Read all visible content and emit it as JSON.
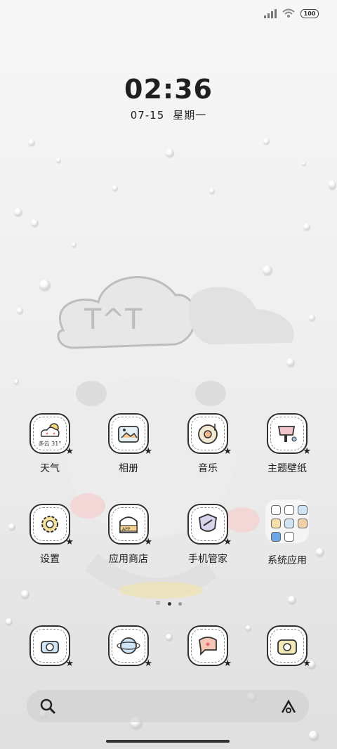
{
  "status_bar": {
    "battery": "100"
  },
  "clock": {
    "time": "02:36",
    "date": "07-15",
    "weekday": "星期一"
  },
  "apps_row1": [
    {
      "label": "天气",
      "mini": "多云 31°"
    },
    {
      "label": "相册"
    },
    {
      "label": "音乐"
    },
    {
      "label": "主题壁纸"
    }
  ],
  "apps_row2": [
    {
      "label": "设置"
    },
    {
      "label": "应用商店"
    },
    {
      "label": "手机管家"
    },
    {
      "label": "系统应用"
    }
  ],
  "dock": [
    "camera-icon",
    "browser-icon",
    "messages-icon",
    "gallery-camera-icon"
  ],
  "pages": {
    "count": 3,
    "active": 2
  }
}
